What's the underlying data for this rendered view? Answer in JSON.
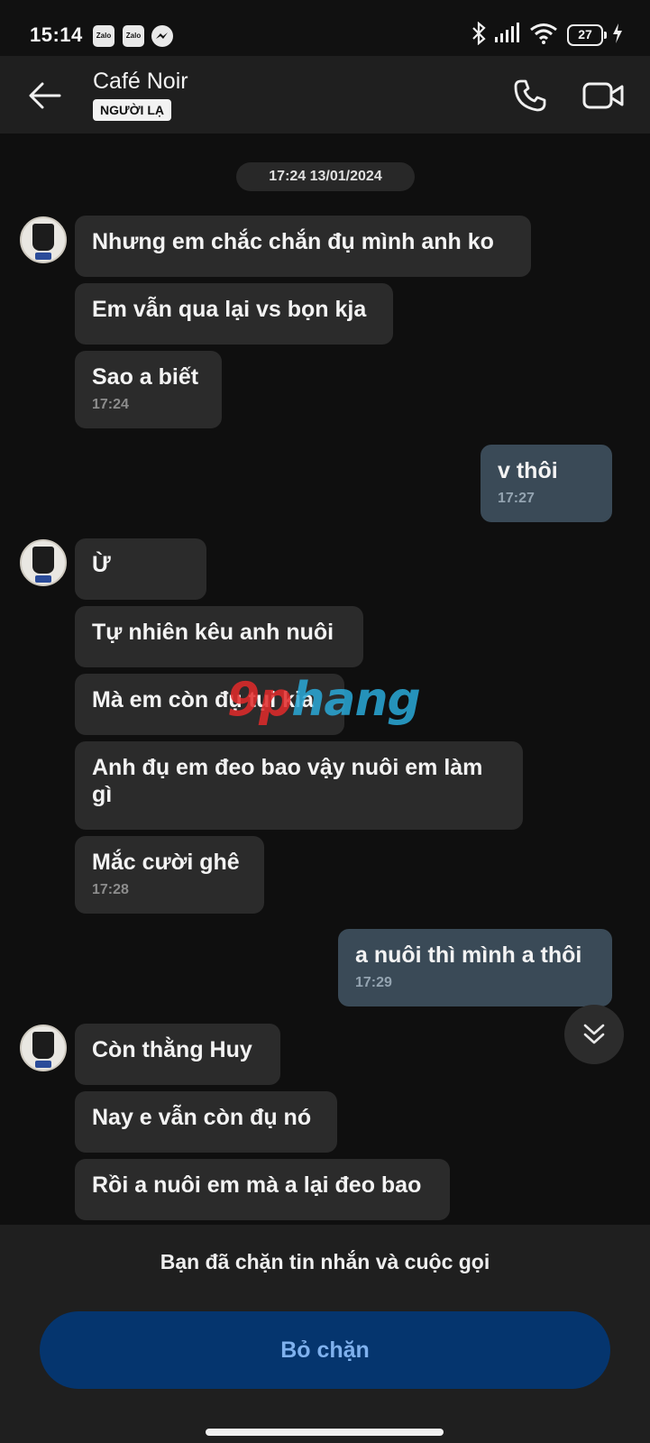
{
  "status_bar": {
    "time": "15:14",
    "notifications": [
      "zalo-icon",
      "zalo-icon",
      "messenger-icon"
    ],
    "notif_label_zalo": "Zalo",
    "battery": "27",
    "icons": [
      "bluetooth-icon",
      "signal-icon",
      "wifi-icon",
      "battery-icon",
      "charging-icon"
    ]
  },
  "header": {
    "name": "Café Noir",
    "badge": "NGƯỜI LẠ"
  },
  "chat": {
    "date": "17:24 13/01/2024",
    "messages": [
      {
        "dir": "in",
        "text": "Nhưng em chắc chắn đụ mình anh ko"
      },
      {
        "dir": "in",
        "text": "Em vẫn qua lại vs bọn kja"
      },
      {
        "dir": "in",
        "text": "Sao a biết",
        "time": "17:24"
      },
      {
        "dir": "out",
        "text": "v thôi",
        "time": "17:27"
      },
      {
        "dir": "in",
        "text": "Ừ"
      },
      {
        "dir": "in",
        "text": "Tự nhiên kêu anh nuôi"
      },
      {
        "dir": "in",
        "text": "Mà em còn đụ tụi kia"
      },
      {
        "dir": "in",
        "text": "Anh đụ em đeo bao vậy nuôi em làm gì"
      },
      {
        "dir": "in",
        "text": "Mắc cười ghê",
        "time": "17:28"
      },
      {
        "dir": "out",
        "text": "a nuôi thì mình a thôi",
        "time": "17:29"
      },
      {
        "dir": "in",
        "text": "Còn thằng Huy"
      },
      {
        "dir": "in",
        "text": "Nay e vẫn còn đụ nó"
      },
      {
        "dir": "in",
        "text": "Rồi a nuôi em mà a lại đeo bao"
      }
    ],
    "watermark_a": "9p",
    "watermark_b": "hang"
  },
  "blocked": {
    "notice": "Bạn đã chặn tin nhắn và cuộc gọi",
    "unblock_label": "Bỏ chặn"
  },
  "colors": {
    "incoming_bubble": "#2b2b2b",
    "outgoing_bubble": "#3a4a57",
    "unblock_button": "#05356e",
    "unblock_text": "#7fb1ee"
  }
}
